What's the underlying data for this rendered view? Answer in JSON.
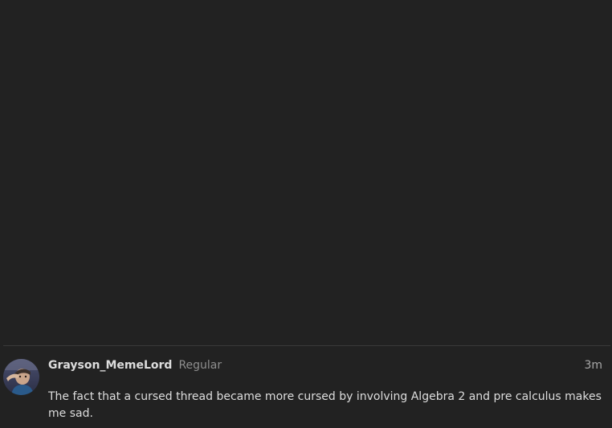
{
  "post": {
    "username": "Grayson_MemeLord",
    "user_title": "Regular",
    "time": "3m",
    "body": "The fact that a cursed thread became more cursed by involving Algebra 2 and pre calculus makes me sad.",
    "avatar_icon": "user-avatar"
  },
  "colors": {
    "background": "#222222",
    "text": "#dddddd",
    "muted": "#8e8e8e",
    "divider": "#3a3a3a"
  }
}
